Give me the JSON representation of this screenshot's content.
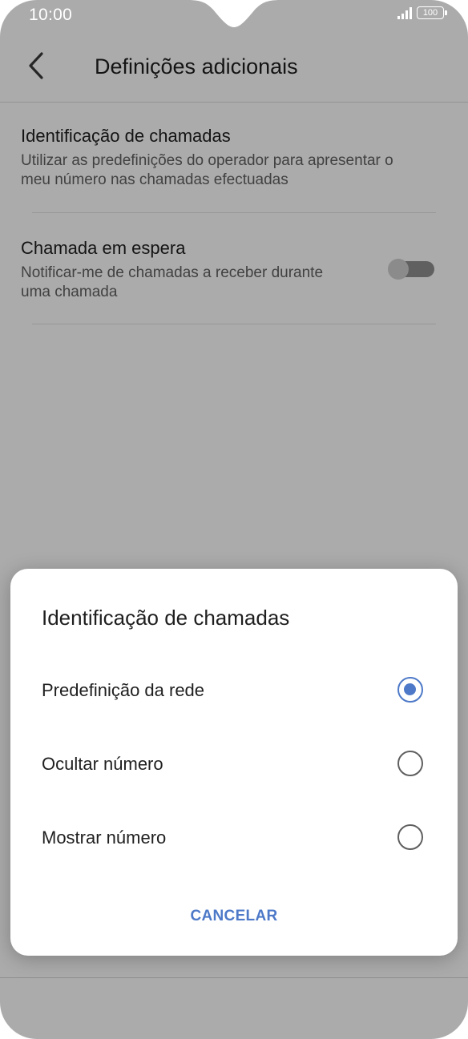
{
  "status_bar": {
    "time": "10:00",
    "battery": "100",
    "icons": [
      "signal-icon",
      "battery-icon"
    ]
  },
  "app_bar": {
    "title": "Definições adicionais",
    "back_icon": "back-arrow-icon"
  },
  "settings": {
    "items": [
      {
        "title": "Identificação de chamadas",
        "subtitle_line1": "Utilizar as predefinições do operador para apresentar o",
        "subtitle_line2": "meu número nas chamadas efectuadas"
      },
      {
        "title": "Chamada em espera",
        "subtitle_line1": "Notificar-me de chamadas a receber durante",
        "subtitle_line2": "uma chamada",
        "toggle_on": false
      }
    ]
  },
  "dialog": {
    "title": "Identificação de chamadas",
    "options": [
      {
        "label": "Predefinição da rede",
        "selected": true
      },
      {
        "label": "Ocultar número",
        "selected": false
      },
      {
        "label": "Mostrar número",
        "selected": false
      }
    ],
    "cancel_label": "CANCELAR"
  },
  "nav_bar": {
    "icons": [
      "nav-back-icon",
      "nav-home-icon",
      "nav-menu-icon"
    ]
  },
  "colors": {
    "accent": "#4d79c8",
    "text_primary": "#1f1f1f",
    "text_secondary": "#616161"
  }
}
